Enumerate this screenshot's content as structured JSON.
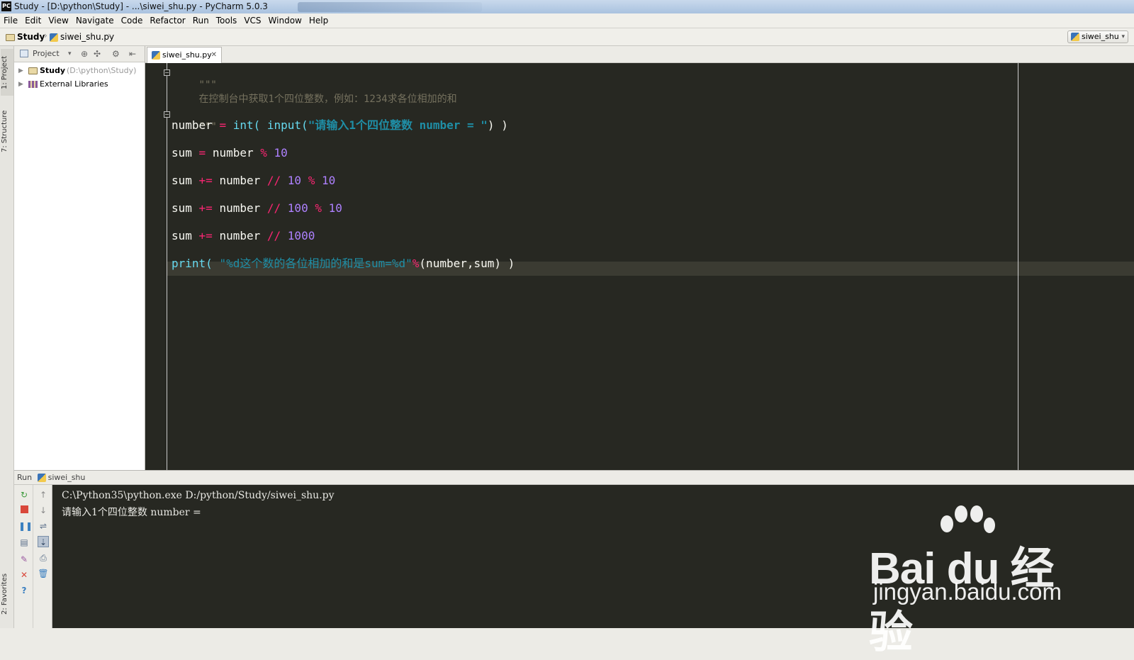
{
  "window": {
    "title": "Study - [D:\\python\\Study] - ...\\siwei_shu.py - PyCharm 5.0.3",
    "app_icon": "PC"
  },
  "menu": [
    "File",
    "Edit",
    "View",
    "Navigate",
    "Code",
    "Refactor",
    "Run",
    "Tools",
    "VCS",
    "Window",
    "Help"
  ],
  "breadcrumb": {
    "project": "Study",
    "file": "siwei_shu.py"
  },
  "run_config": {
    "label": "siwei_shu"
  },
  "left_stripe": {
    "project_tab": "1: Project",
    "structure_tab": "7: Structure",
    "favorites_tab": "2: Favorites"
  },
  "project_panel": {
    "view_label": "Project",
    "tree": [
      {
        "name": "Study",
        "path": "(D:\\python\\Study)"
      },
      {
        "name": "External Libraries"
      }
    ]
  },
  "editor": {
    "tab_label": "siwei_shu.py",
    "docstring_open": "\"\"\"",
    "docstring_text": "在控制台中获取1个四位整数，例如：1234求各位相加的和",
    "docstring_close": "\"\"\"",
    "line_input": {
      "var": "number",
      "eq": "=",
      "int": "int(",
      "input": "input(",
      "prompt": "\"请输入1个四位整数 number = \"",
      "close": ") )"
    },
    "line_sum1": {
      "var": "sum",
      "eq": "=",
      "name": "number",
      "op": "%",
      "num": "10"
    },
    "line_sum2": {
      "var": "sum",
      "eq": "+=",
      "name": "number",
      "op1": "//",
      "num1": "10",
      "op2": "%",
      "num2": "10"
    },
    "line_sum3": {
      "var": "sum",
      "eq": "+=",
      "name": "number",
      "op1": "//",
      "num1": "100",
      "op2": "%",
      "num2": "10"
    },
    "line_sum4": {
      "var": "sum",
      "eq": "+=",
      "name": "number",
      "op1": "//",
      "num1": "1000"
    },
    "line_print": {
      "print": "print(",
      "fmt": "\"%d这个数的各位相加的和是sum=%d\"",
      "op": "%",
      "args": "(number,sum) )"
    }
  },
  "run_panel": {
    "header_label": "Run",
    "config_name": "siwei_shu",
    "console_lines": [
      "C:\\Python35\\python.exe D:/python/Study/siwei_shu.py",
      "请输入1个四位整数 number ="
    ]
  },
  "watermark": {
    "brand": "Bai du 经验",
    "url": "jingyan.baidu.com"
  },
  "colors": {
    "editor_bg": "#272822",
    "keyword_op": "#f92672",
    "number": "#ae81ff",
    "builtin": "#66d9ef",
    "string": "#1f8ea6",
    "comment": "#75715e"
  }
}
